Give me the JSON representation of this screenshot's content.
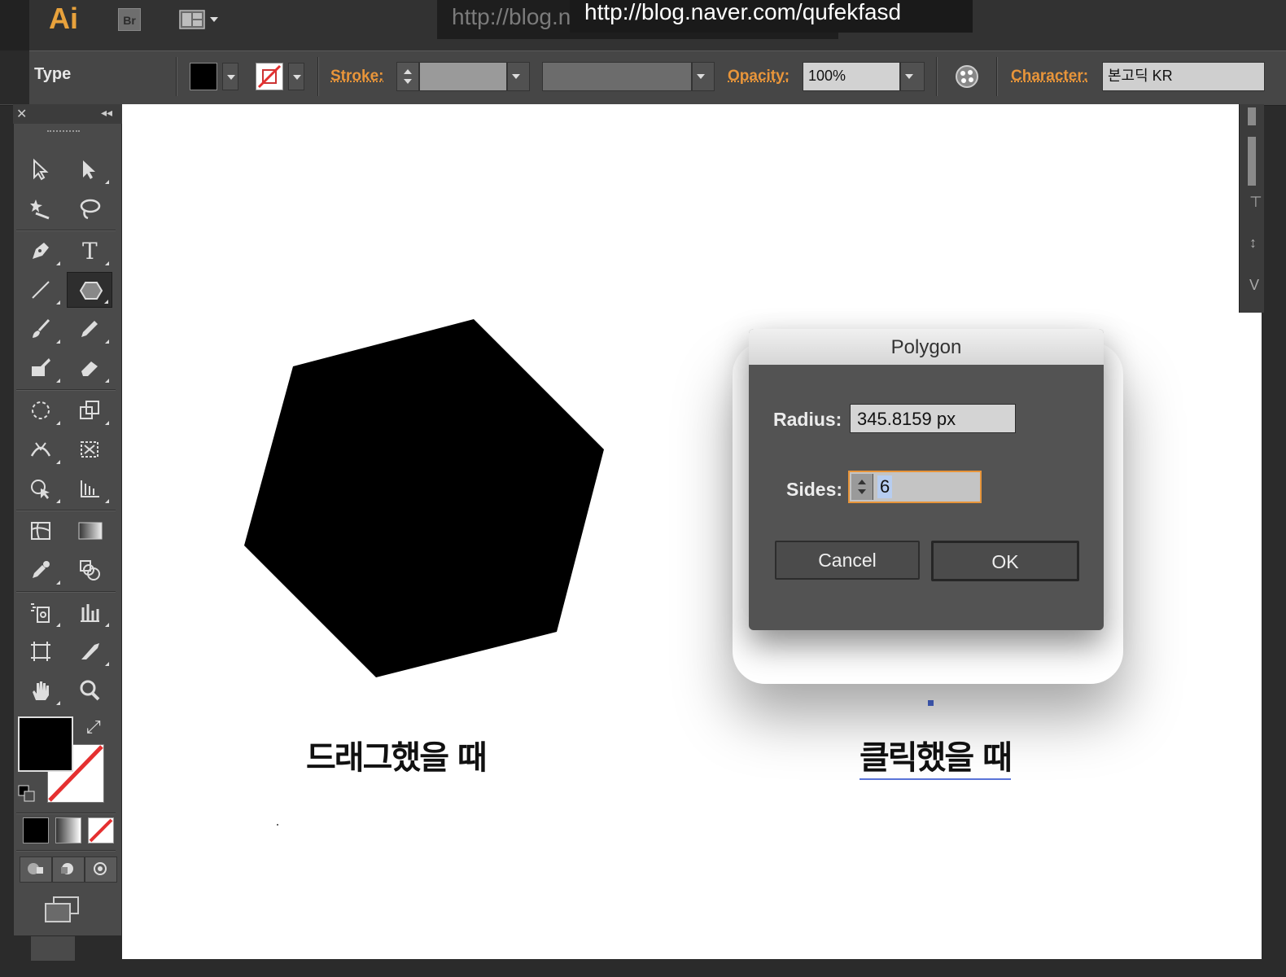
{
  "app": {
    "logo": "Ai",
    "bridge_label": "Br",
    "url_overlay_back": "http://blog.naver.com/qufekfasd",
    "url_overlay_front": "http://blog.naver.com/qufekfasd"
  },
  "control_bar": {
    "type_label": "Type",
    "stroke_label": "Stroke:",
    "opacity_label": "Opacity:",
    "opacity_value": "100%",
    "character_label": "Character:",
    "font_value": "본고딕 KR"
  },
  "canvas": {
    "caption_left": "드래그했을 때",
    "caption_right": "클릭했을 때",
    "shape_fill": "#000000"
  },
  "dialog": {
    "title": "Polygon",
    "radius_label": "Radius:",
    "radius_value": "345.8159 px",
    "sides_label": "Sides:",
    "sides_value": "6",
    "cancel_label": "Cancel",
    "ok_label": "OK"
  },
  "colors": {
    "accent_orange": "#e8953a",
    "focus_ring": "#e8953a",
    "fill_swatch": "#000000",
    "none_slash": "#e53030"
  }
}
